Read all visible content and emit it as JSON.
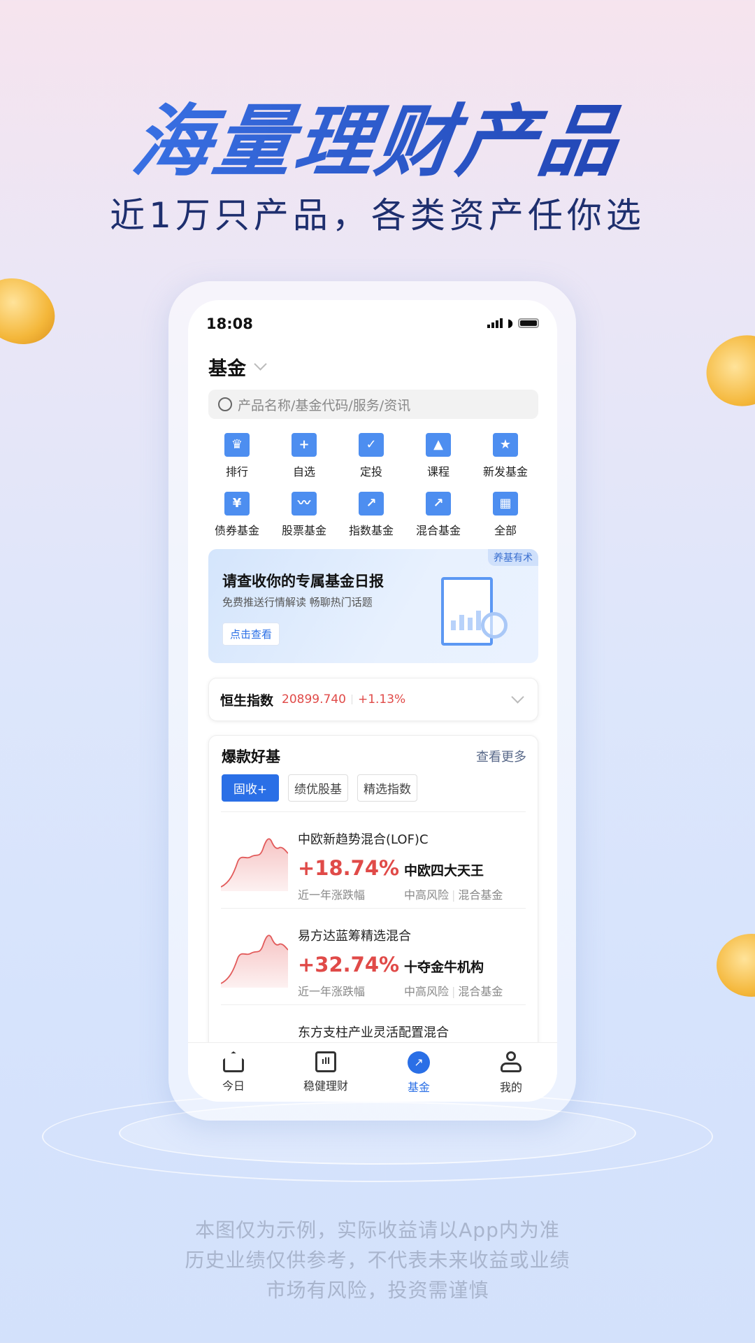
{
  "hero": {
    "title": "海量理财产品",
    "subtitle": "近1万只产品，各类资产任你选"
  },
  "status_bar": {
    "time": "18:08"
  },
  "header": {
    "title": "基金"
  },
  "search": {
    "placeholder": "产品名称/基金代码/服务/资讯"
  },
  "quick_grid": [
    {
      "label": "排行",
      "icon": "trophy-icon"
    },
    {
      "label": "自选",
      "icon": "bookmark-plus-icon"
    },
    {
      "label": "定投",
      "icon": "calendar-check-icon"
    },
    {
      "label": "课程",
      "icon": "graduation-cap-icon"
    },
    {
      "label": "新发基金",
      "icon": "bag-star-icon"
    },
    {
      "label": "债券基金",
      "icon": "ticket-yen-icon"
    },
    {
      "label": "股票基金",
      "icon": "stock-chart-icon"
    },
    {
      "label": "指数基金",
      "icon": "trend-up-icon"
    },
    {
      "label": "混合基金",
      "icon": "stacked-chart-icon"
    },
    {
      "label": "全部",
      "icon": "grid-icon"
    }
  ],
  "banner": {
    "title": "请查收你的专属基金日报",
    "subtitle": "免费推送行情解读 畅聊热门话题",
    "button": "点击查看",
    "tag": "养基有术"
  },
  "index_card": {
    "name": "恒生指数",
    "value": "20899.740",
    "change": "+1.13%"
  },
  "hot_funds": {
    "title": "爆款好基",
    "more": "查看更多",
    "tabs": [
      "固收+",
      "绩优股基",
      "精选指数"
    ],
    "active_tab": 0,
    "items": [
      {
        "name": "中欧新趋势混合(LOF)C",
        "return": "+18.74%",
        "return_label": "近一年涨跌幅",
        "tag": "中欧四大天王",
        "risk": "中高风险",
        "type": "混合基金"
      },
      {
        "name": "易方达蓝筹精选混合",
        "return": "+32.74%",
        "return_label": "近一年涨跌幅",
        "tag": "十夺金牛机构",
        "risk": "中高风险",
        "type": "混合基金"
      },
      {
        "name": "东方支柱产业灵活配置混合"
      }
    ]
  },
  "bottom_nav": [
    {
      "label": "今日",
      "icon": "home-icon"
    },
    {
      "label": "稳健理财",
      "icon": "bar-chart-icon"
    },
    {
      "label": "基金",
      "icon": "fund-icon",
      "active": true
    },
    {
      "label": "我的",
      "icon": "user-icon"
    }
  ],
  "disclaimer": [
    "本图仅为示例，实际收益请以App内为准",
    "历史业绩仅供参考，不代表未来收益或业绩",
    "市场有风险，投资需谨慎"
  ],
  "colors": {
    "accent": "#2a6fe6",
    "icon_blue": "#4d8ef0",
    "up_red": "#e04a48"
  }
}
